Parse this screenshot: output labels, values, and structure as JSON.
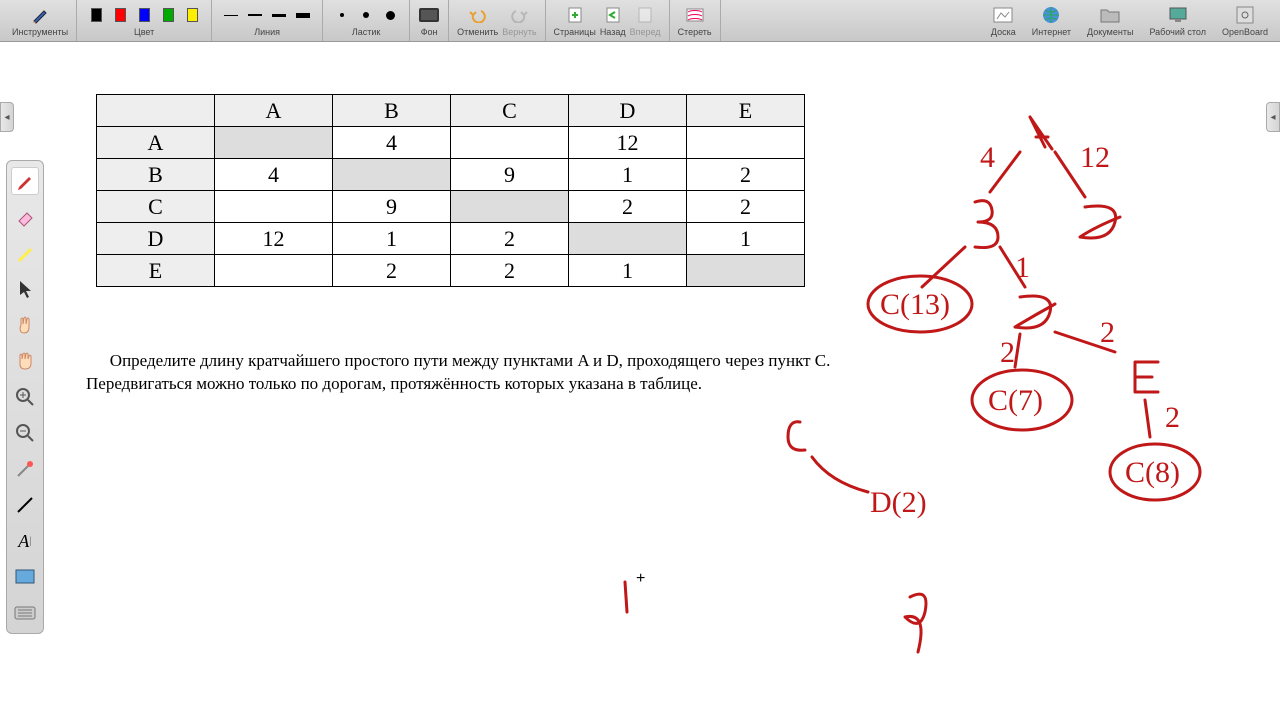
{
  "toolbar": {
    "tools_label": "Инструменты",
    "color_label": "Цвет",
    "line_label": "Линия",
    "eraser_label": "Ластик",
    "bg_label": "Фон",
    "undo_label": "Отменить",
    "redo_label": "Вернуть",
    "pages_label": "Страницы",
    "back_label": "Назад",
    "forward_label": "Вперед",
    "erase_label": "Стереть",
    "board_label": "Доска",
    "internet_label": "Интернет",
    "documents_label": "Документы",
    "desktop_label": "Рабочий стол",
    "openboard_label": "OpenBoard",
    "colors": [
      "#000000",
      "#ff0000",
      "#0000ff",
      "#00aa00",
      "#ffee00"
    ],
    "eraser_sizes": [
      4,
      6,
      9
    ]
  },
  "table": {
    "headers": [
      "",
      "A",
      "B",
      "C",
      "D",
      "E"
    ],
    "rows": [
      {
        "label": "A",
        "cells": [
          "shade",
          "4",
          "",
          "12",
          ""
        ]
      },
      {
        "label": "B",
        "cells": [
          "4",
          "shade",
          "9",
          "1",
          "2"
        ]
      },
      {
        "label": "C",
        "cells": [
          "",
          "9",
          "shade",
          "2",
          "2"
        ]
      },
      {
        "label": "D",
        "cells": [
          "12",
          "1",
          "2",
          "shade",
          "1"
        ]
      },
      {
        "label": "E",
        "cells": [
          "",
          "2",
          "2",
          "1",
          "shade"
        ]
      }
    ]
  },
  "problem": "Определите длину кратчайшего простого пути между пунктами A и D, проходящего через пункт C. Передвигаться можно только по дорогам, протяжённость которых указана в таблице.",
  "handwriting": {
    "nodes": [
      "A",
      "B",
      "D",
      "C(13)",
      "D",
      "C(7)",
      "E",
      "C(8)",
      "C",
      "D(2)"
    ],
    "edge_labels": [
      "4",
      "12",
      "1",
      "2",
      "2",
      "2"
    ],
    "loose": [
      "9"
    ]
  }
}
